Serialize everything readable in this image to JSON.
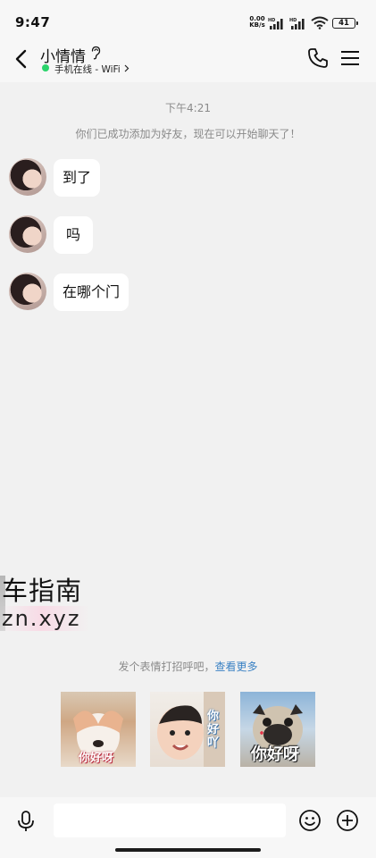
{
  "status_bar": {
    "time": "9:47",
    "net_speed_value": "0.00",
    "net_speed_unit": "KB/s",
    "hd_label": "HD",
    "battery": "41"
  },
  "header": {
    "contact_name": "小情情",
    "online_status": "手机在线 - WiFi",
    "online_color": "#2bd46b"
  },
  "chat": {
    "time_divider": "下午4:21",
    "system_notice": "你们已成功添加为好友，现在可以开始聊天了！",
    "messages": [
      {
        "text": "到了"
      },
      {
        "text": "吗"
      },
      {
        "text": "在哪个门"
      }
    ]
  },
  "watermark": {
    "line1": "车指南",
    "line2": "zn.xyz"
  },
  "sticker_suggestion": {
    "hint": "发个表情打招呼吧，",
    "more_link": "查看更多",
    "link_color": "#3b82c4",
    "stickers": [
      {
        "caption": "你好呀",
        "icon": "dog-sticker"
      },
      {
        "caption": "你好吖",
        "icon": "baby-sticker"
      },
      {
        "caption": "你好呀",
        "icon": "pug-sticker"
      }
    ]
  },
  "input_bar": {
    "placeholder": "",
    "icons": [
      "microphone-icon",
      "emoji-icon",
      "plus-icon"
    ]
  }
}
